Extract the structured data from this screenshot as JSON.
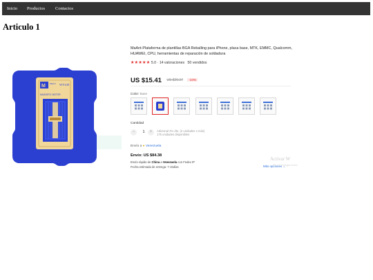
{
  "nav": {
    "items": [
      "Inicio",
      "Productos",
      "Contactos"
    ]
  },
  "page": {
    "title": "Articulo 1"
  },
  "product": {
    "title": "MaAnt-Plataforma de plantillas BGA Reballing para iPhone, placa base, MTK, EMMC, Qualcomm, HUAWEI, CPU, herramientas de reparación de soldadura",
    "image_label_brand": "MaAnt",
    "image_label_model": "WYLIE",
    "image_label_caption": "MAGNETIC MOTOR",
    "rating_stars": "★★★★★",
    "rating_value": "5.0",
    "rating_separator": "·",
    "reviews": "14 valoraciones",
    "sold": "50 vendidos",
    "price": "US $15.41",
    "old_price": "US $20.27",
    "discount": "-24%",
    "color_label": "Color:",
    "color_selected": "Base",
    "swatch_count": 7,
    "selected_swatch": 1,
    "quantity_label": "Cantidad",
    "qty_minus": "−",
    "qty_value": "1",
    "qty_plus": "+",
    "qty_note_line1": "Adicional 2% dto. (2 unidades o más)",
    "qty_note_line2": "175 unidades disponibles",
    "ship_to_label": "Envío a",
    "ship_to_country": "Venezuela",
    "ship_cost": "Envío: US $84.38",
    "ship_line1_prefix": "Envío rápido de",
    "ship_from": "China",
    "ship_a": "a",
    "ship_dest": "Venezuela",
    "ship_via": "con Fedex IP",
    "ship_line2": "Fecha estimada de entrega: 7-15días",
    "more_options": "Más opciones",
    "chevron_icon": "chevron-down-icon"
  },
  "watermark": {
    "line1": "Activar W",
    "line2": "Ve a Configuración"
  },
  "colors": {
    "accent_red": "#e02424",
    "link_blue": "#2a6fdb",
    "nav_bg": "#333333",
    "product_blue": "#2b3fd0",
    "plate_gold": "#f1d79a"
  }
}
